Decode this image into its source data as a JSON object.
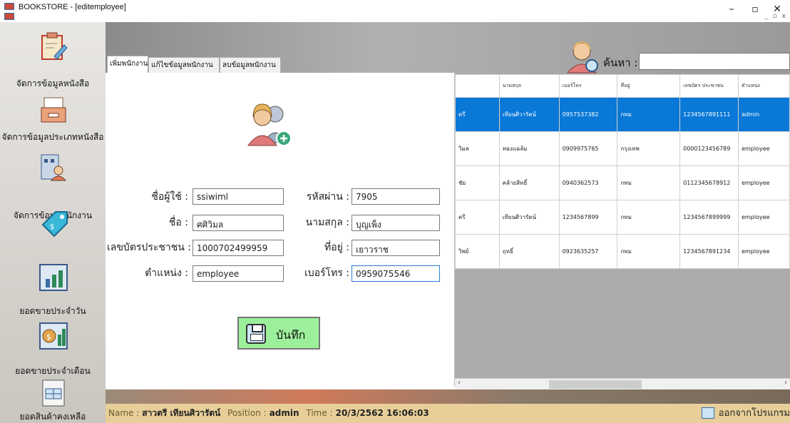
{
  "window": {
    "title": "BOOKSTORE - [editemployee]",
    "mdi_controls": "_ ▫ x"
  },
  "sidebar": {
    "items": [
      {
        "label": "จัดการข้อมูลหนังสือ",
        "icon": "clipboard-edit-icon"
      },
      {
        "label": "จัดการข้อมูลประเภทหนังสือ",
        "icon": "file-tray-icon"
      },
      {
        "label": "จัดการข้อมูลพนักงาน",
        "icon": "employee-building-icon"
      },
      {
        "label": "ขาย",
        "icon": "price-tag-icon"
      },
      {
        "label": "ยอดขายประจำวัน",
        "icon": "bar-chart-icon"
      },
      {
        "label": "ยอดขายประจำเดือน",
        "icon": "money-chart-icon"
      },
      {
        "label": "ยอดสินค้าคงเหลือ",
        "icon": "inventory-sheet-icon"
      }
    ]
  },
  "tabs": [
    {
      "label": "เพิ่มพนักงาน"
    },
    {
      "label": "แก้ไขข้อมูลพนักงาน"
    },
    {
      "label": "ลบข้อมูลพนักงาน"
    }
  ],
  "form": {
    "username_label": "ชื่อผู้ใช้ :",
    "username_value": "ssiwiml",
    "password_label": "รหัสผ่าน :",
    "password_value": "7905",
    "firstname_label": "ชื่อ :",
    "firstname_value": "ศศิวิมล",
    "lastname_label": "นามสกุล :",
    "lastname_value": "บุญเพ็ง",
    "idcard_label": "เลขบัตรประชาชน :",
    "idcard_value": "1000702499959",
    "address_label": "ที่อยู่ :",
    "address_value": "เยาวราช",
    "position_label": "ตำแหน่ง :",
    "position_value": "employee",
    "phone_label": "เบอร์โทร :",
    "phone_value": "0959075546",
    "save_label": "บันทึก"
  },
  "search": {
    "label": "ค้นหา :",
    "value": ""
  },
  "grid": {
    "columns": [
      "",
      "นามสกุล",
      "เบอร์โทร",
      "ที่อยู่",
      "เลขบัตร ประชาชน",
      "ตำแหน่ง"
    ],
    "rows": [
      [
        "ตรี",
        "เทียนศิวารัตน์",
        "0957537382",
        "กทม",
        "1234567891111",
        "admin"
      ],
      [
        "วิมล",
        "ทองแฉล้ม",
        "0909975765",
        "กรุงเทพ",
        "0000123456789",
        "employee"
      ],
      [
        "ชัย",
        "คล้ายสิทธิ์",
        "0940362573",
        "กทม",
        "0112345678912",
        "employee"
      ],
      [
        "ตรี",
        "เทียนศิวารัตน์",
        "1234567899",
        "กทม",
        "1234567899999",
        "employee"
      ],
      [
        "วิพย์",
        "ฤทธิ์",
        "0923635257",
        "กทม",
        "1234567891234",
        "employee"
      ]
    ]
  },
  "status": {
    "name_key": "Name :",
    "name_value": "สาวตรี เทียนศิวารัตน์",
    "position_key": "Position :",
    "position_value": "admin",
    "time_key": "Time :",
    "time_value": "20/3/2562 16:06:03",
    "exit_label": "ออกจากโปรแกรม"
  },
  "colors": {
    "selected_row": "#0a78d7",
    "save_button": "#9df09b",
    "statusbar": "#e8cf9a"
  }
}
